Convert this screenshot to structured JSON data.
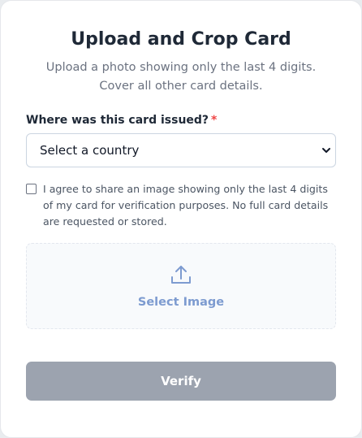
{
  "card": {
    "title": "Upload and Crop Card",
    "subtitle": "Upload a photo showing only the last 4 digits. Cover all other card details."
  },
  "country": {
    "label": "Where was this card issued?",
    "required_marker": "*",
    "selected": "Select a country"
  },
  "consent": {
    "checked": false,
    "text": "I agree to share an image showing only the last 4 digits of my card for verification purposes. No full card details are requested or stored."
  },
  "upload": {
    "icon": "upload-icon",
    "label": "Select Image"
  },
  "actions": {
    "verify_label": "Verify"
  },
  "colors": {
    "accent": "#7d9bd0",
    "required": "#ef4444",
    "button_disabled": "#9ca3af"
  }
}
